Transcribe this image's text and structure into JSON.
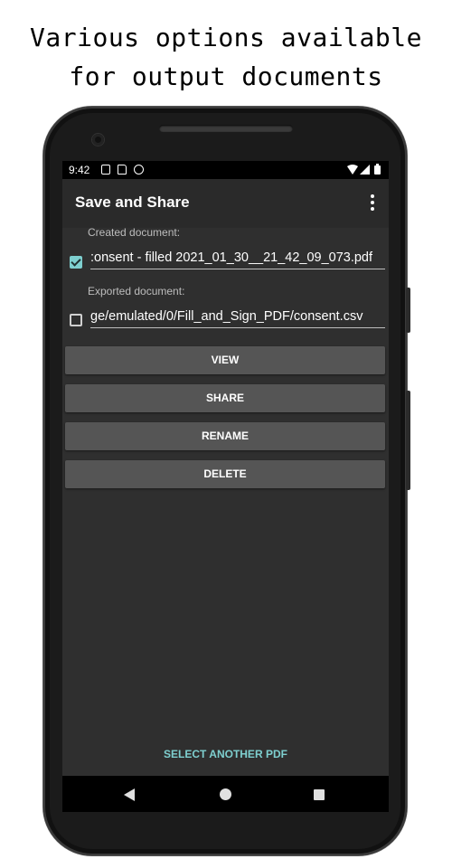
{
  "promo": {
    "line1": "Various options available",
    "line2": "for output documents"
  },
  "statusbar": {
    "time": "9:42",
    "icons": [
      "notification-a-icon",
      "sd-card-icon",
      "sync-icon",
      "wifi-icon",
      "signal-icon",
      "battery-icon"
    ]
  },
  "appbar": {
    "title": "Save and Share",
    "menu_icon": "more-vert-icon"
  },
  "created": {
    "label": "Created document:",
    "checked": true,
    "value": ":onsent - filled 2021_01_30__21_42_09_073.pdf"
  },
  "exported": {
    "label": "Exported document:",
    "checked": false,
    "value": "ge/emulated/0/Fill_and_Sign_PDF/consent.csv"
  },
  "actions": {
    "view": "VIEW",
    "share": "SHARE",
    "rename": "RENAME",
    "delete": "DELETE"
  },
  "footer": {
    "select_another": "SELECT ANOTHER PDF"
  },
  "colors": {
    "accent": "#7ecfcf",
    "background": "#2f2f2f",
    "button": "#555555"
  }
}
